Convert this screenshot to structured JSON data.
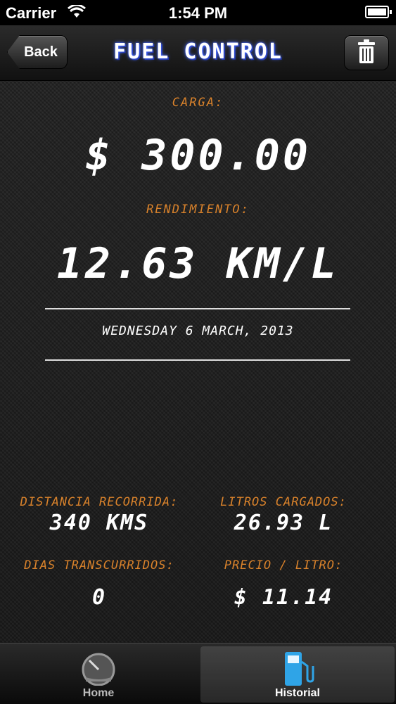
{
  "status_bar": {
    "carrier": "Carrier",
    "time": "1:54 PM"
  },
  "navbar": {
    "back_label": "Back",
    "title": "Fuel Control",
    "trash_icon": "trash-icon"
  },
  "summary": {
    "carga_label": "Carga:",
    "carga_value": "$ 300.00",
    "rendimiento_label": "Rendimiento:",
    "rendimiento_value": "12.63 KM/L",
    "date": "Wednesday 6 March, 2013"
  },
  "stats": {
    "distancia_label": "Distancia recorrida:",
    "distancia_value": "340 KMS",
    "litros_label": "Litros cargados:",
    "litros_value": "26.93 L",
    "dias_label": "Dias transcurridos:",
    "dias_value": "0",
    "precio_label": "Precio / Litro:",
    "precio_value": "$ 11.14"
  },
  "tabbar": {
    "tabs": [
      {
        "label": "Home",
        "icon": "gauge-icon",
        "selected": false
      },
      {
        "label": "Historial",
        "icon": "fuel-pump-icon",
        "selected": true
      }
    ]
  },
  "colors": {
    "label_orange": "#d9822b",
    "background": "#1e1e1e",
    "title_glow": "#4b6fff"
  }
}
